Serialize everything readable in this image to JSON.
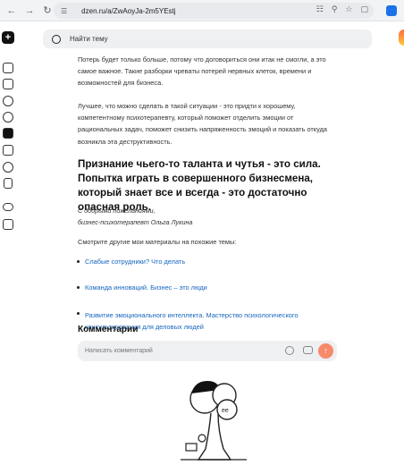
{
  "browser": {
    "url": "dzen.ru/a/ZwAoyJa-2m5YEstj"
  },
  "search": {
    "placeholder": "Найти тему"
  },
  "article": {
    "paragraph1": "Потерь будет только больше, потому что договориться они итак не смогли, а это самое важное. Такие разборки чреваты потерей нервных клеток, времени и возможностей для бизнеса.",
    "paragraph2": "Лучшее, что можно сделать в такой ситуации - это придти к хорошему, компетентному психотерапевту, который поможет отделить эмоции от рациональных задач, поможет снизить напряженность эмоций и показать откуда возникла эта деструктивность.",
    "heading": "Признание чьего-то таланта и чутья - это сила. Попытка играть в совершенного бизнесмена, который знает все и всегда - это достаточно опасная роль.",
    "signature_line1": "С добрыми пожеланиями,",
    "signature_line2": "бизнес-психотерапевт Ольга Лукина",
    "see_also": "Смотрите другие мои материалы на похожие темы:",
    "links": [
      "Слабые сотрудники? Что делать",
      "Команда инноваций. Бизнес – это люди",
      "Развитие эмоционального интеллекта. Мастерство психологического консультирования для деловых людей"
    ]
  },
  "comments": {
    "title": "Комментарии",
    "placeholder": "Написать комментарий"
  },
  "colors": {
    "link": "#1565c0",
    "send_button": "#f68a6a",
    "search_bg": "#eef0f2"
  },
  "icons": {
    "sidebar": [
      "logo-icon",
      "home-icon",
      "add-post-icon",
      "explore-icon",
      "video-icon",
      "articles-icon",
      "subscriptions-icon",
      "shorts-icon",
      "bookmark-icon",
      "games-icon",
      "cat-icon"
    ]
  }
}
